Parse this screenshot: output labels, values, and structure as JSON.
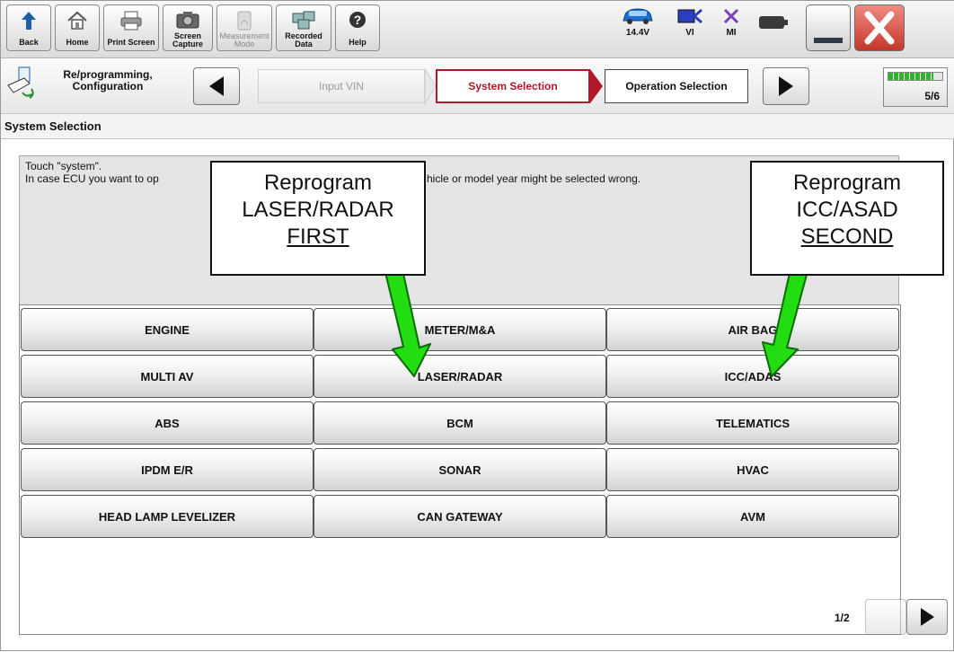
{
  "toolbar": {
    "back_label": "Back",
    "home_label": "Home",
    "print_label": "Print Screen",
    "capture_label": "Screen Capture",
    "measure_label": "Measurement Mode",
    "recorded_label": "Recorded Data",
    "help_label": "Help",
    "voltage": "14.4V",
    "vi_label": "VI",
    "mi_label": "MI"
  },
  "breadcrumb": {
    "home_label": "Re/programming, Configuration",
    "step_input": "Input VIN",
    "step_system": "System Selection",
    "step_operation": "Operation Selection",
    "progress_text": "5/6",
    "progress_fraction": 0.83
  },
  "section": {
    "title": "System Selection"
  },
  "message": {
    "line1": "Touch \"system\".",
    "line2": "In case ECU you want to op",
    "line2b": "hicle or model year might be selected wrong."
  },
  "systems": [
    [
      "ENGINE",
      "METER/M&A",
      "AIR BAG"
    ],
    [
      "MULTI AV",
      "LASER/RADAR",
      "ICC/ADAS"
    ],
    [
      "ABS",
      "BCM",
      "TELEMATICS"
    ],
    [
      "IPDM E/R",
      "SONAR",
      "HVAC"
    ],
    [
      "HEAD LAMP LEVELIZER",
      "CAN GATEWAY",
      "AVM"
    ]
  ],
  "pager": {
    "text": "1/2"
  },
  "callouts": {
    "left": {
      "line1": "Reprogram",
      "line2": "LASER/RADAR",
      "line3": "FIRST"
    },
    "right": {
      "line1": "Reprogram",
      "line2": "ICC/ASAD",
      "line3": "SECOND"
    }
  },
  "colors": {
    "accent_red": "#b0182c",
    "progress_green": "#2bb52b",
    "arrow_green": "#22dd11",
    "close_red": "#d94a3f"
  },
  "icons": [
    "back-arrow-icon",
    "home-icon",
    "printer-icon",
    "camera-icon",
    "gauge-icon",
    "recorded-data-icon",
    "help-icon",
    "car-battery-icon",
    "vi-connection-icon",
    "mi-cross-icon",
    "battery-status-icon",
    "minimize-icon",
    "close-icon",
    "reprogramming-icon",
    "triangle-left-icon",
    "triangle-right-icon"
  ]
}
